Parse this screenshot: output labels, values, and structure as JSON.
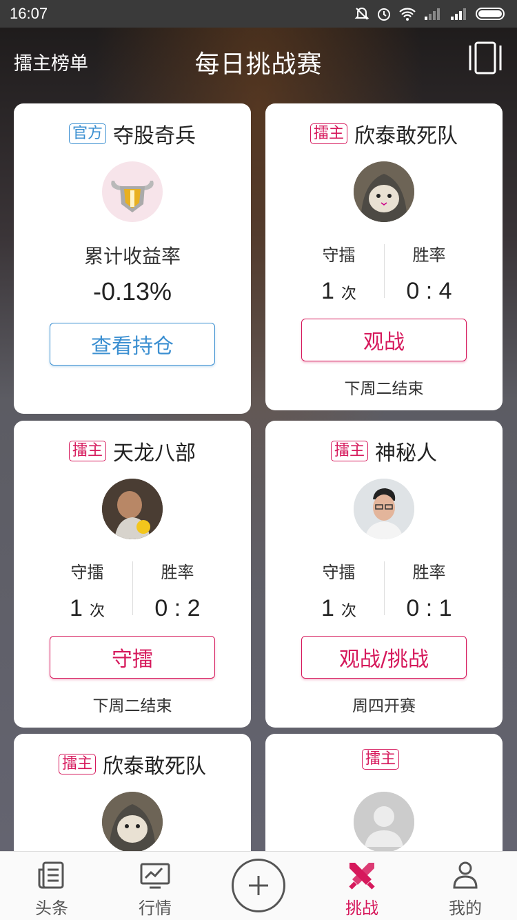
{
  "status": {
    "time": "16:07"
  },
  "header": {
    "left_label": "擂主榜单",
    "title": "每日挑战赛"
  },
  "cards": [
    {
      "badge": "官方",
      "name": "夺股奇兵",
      "metric_label": "累计收益率",
      "metric_value": "-0.13%",
      "button": "查看持仓"
    },
    {
      "badge": "擂主",
      "name": "欣泰敢死队",
      "stat1_label": "守擂",
      "stat1_value": "1",
      "stat1_unit": "次",
      "stat2_label": "胜率",
      "stat2_value": "0 : 4",
      "button": "观战",
      "footer": "下周二结束"
    },
    {
      "badge": "擂主",
      "name": "天龙八部",
      "stat1_label": "守擂",
      "stat1_value": "1",
      "stat1_unit": "次",
      "stat2_label": "胜率",
      "stat2_value": "0 : 2",
      "button": "守擂",
      "footer": "下周二结束"
    },
    {
      "badge": "擂主",
      "name": "神秘人",
      "stat1_label": "守擂",
      "stat1_value": "1",
      "stat1_unit": "次",
      "stat2_label": "胜率",
      "stat2_value": "0 : 1",
      "button": "观战/挑战",
      "footer": "周四开赛"
    },
    {
      "badge": "擂主",
      "name": "欣泰敢死队"
    },
    {
      "badge": "擂主",
      "name": ""
    }
  ],
  "tabbar": {
    "items": [
      {
        "label": "头条",
        "icon": "news-icon"
      },
      {
        "label": "行情",
        "icon": "chart-icon"
      },
      {
        "label": "",
        "icon": "plus-icon"
      },
      {
        "label": "挑战",
        "icon": "swords-icon"
      },
      {
        "label": "我的",
        "icon": "person-icon"
      }
    ]
  },
  "colors": {
    "accent": "#d6195c",
    "blue": "#3b8fd1"
  }
}
